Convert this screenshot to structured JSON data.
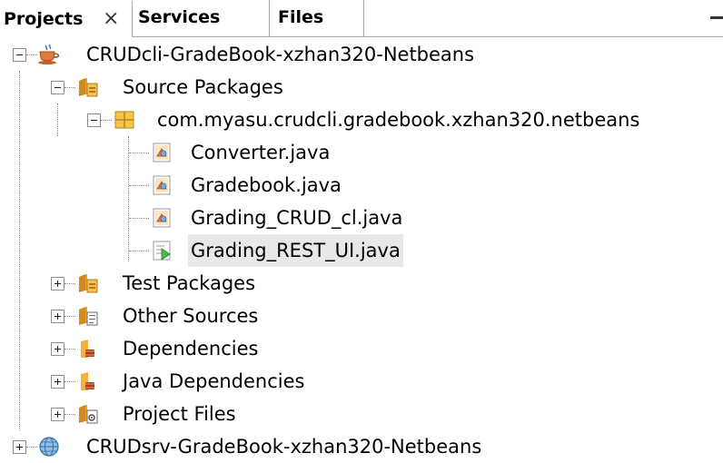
{
  "tabs": [
    {
      "label": "Projects",
      "close": "×"
    },
    {
      "label": "Services"
    },
    {
      "label": "Files"
    }
  ],
  "tree": {
    "project1": "CRUDcli-GradeBook-xzhan320-Netbeans",
    "source_packages": "Source Packages",
    "package": "com.myasu.crudcli.gradebook.xzhan320.netbeans",
    "files": [
      "Converter.java",
      "Gradebook.java",
      "Grading_CRUD_cl.java",
      "Grading_REST_UI.java"
    ],
    "test_packages": "Test Packages",
    "other_sources": "Other Sources",
    "dependencies": "Dependencies",
    "java_dependencies": "Java Dependencies",
    "project_files": "Project Files",
    "project2": "CRUDsrv-GradeBook-xzhan320-Netbeans"
  },
  "colors": {
    "selection": "#e8e8e8",
    "folder": "#f4b23a",
    "package": "#e8a020"
  }
}
